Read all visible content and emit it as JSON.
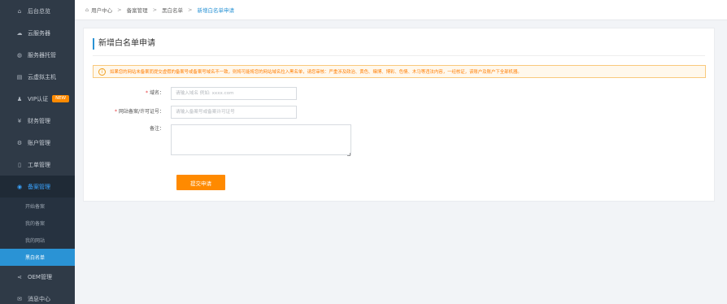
{
  "sidebar": {
    "items": [
      {
        "icon": "home-icon",
        "glyph": "⌂",
        "label": "后台总览"
      },
      {
        "icon": "cloud-server-icon",
        "glyph": "☁",
        "label": "云服务器"
      },
      {
        "icon": "server-hosting-icon",
        "glyph": "◍",
        "label": "服务器托管"
      },
      {
        "icon": "virtual-host-icon",
        "glyph": "▤",
        "label": "云虚拟主机"
      },
      {
        "icon": "user-icon",
        "glyph": "♟",
        "label": "VIP认证",
        "badge": "NEW"
      },
      {
        "icon": "finance-icon",
        "glyph": "¥",
        "label": "财务管理"
      },
      {
        "icon": "account-icon",
        "glyph": "⚙",
        "label": "账户管理"
      },
      {
        "icon": "ticket-icon",
        "glyph": "▯",
        "label": "工单管理"
      },
      {
        "icon": "record-icon",
        "glyph": "◉",
        "label": "备案管理"
      }
    ],
    "submenu": [
      "开始备案",
      "我的备案",
      "我的网站",
      "黑白名单"
    ],
    "bottom_items": [
      {
        "icon": "share-icon",
        "glyph": "⋖",
        "label": "OEM管理"
      },
      {
        "icon": "message-icon",
        "glyph": "✉",
        "label": "消息中心"
      }
    ]
  },
  "breadcrumb": {
    "items": [
      "用户中心",
      "备案管理",
      "黑白名单"
    ],
    "current": "新增白名单申请",
    "separator": ">"
  },
  "page": {
    "title": "新增白名单申请",
    "notice": "如果您的网站未备案而提交虚假的备案号或备案号域名不一致，则将可能将您的网站域名拉入黑名单，请您审核：严重涉及政治、黄色、赌博、博彩、色情、木马等违法内容，一经核证，该账户及账户下全部机器。"
  },
  "form": {
    "domain_label": "域名：",
    "domain_placeholder": "请输入域名 例如: xxxx.com",
    "domain_value": "",
    "icp_label": "网站备案/许可证号：",
    "icp_placeholder": "请输入备案号或备案许可证号",
    "icp_value": "",
    "remark_label": "备注：",
    "remark_value": "",
    "required_mark": "*",
    "submit_label": "提交申请"
  },
  "colors": {
    "sidebar_bg": "#2f3a47",
    "accent_blue": "#2a93d5",
    "submit_orange": "#ff8a00",
    "notice_text": "#ff7d00"
  }
}
